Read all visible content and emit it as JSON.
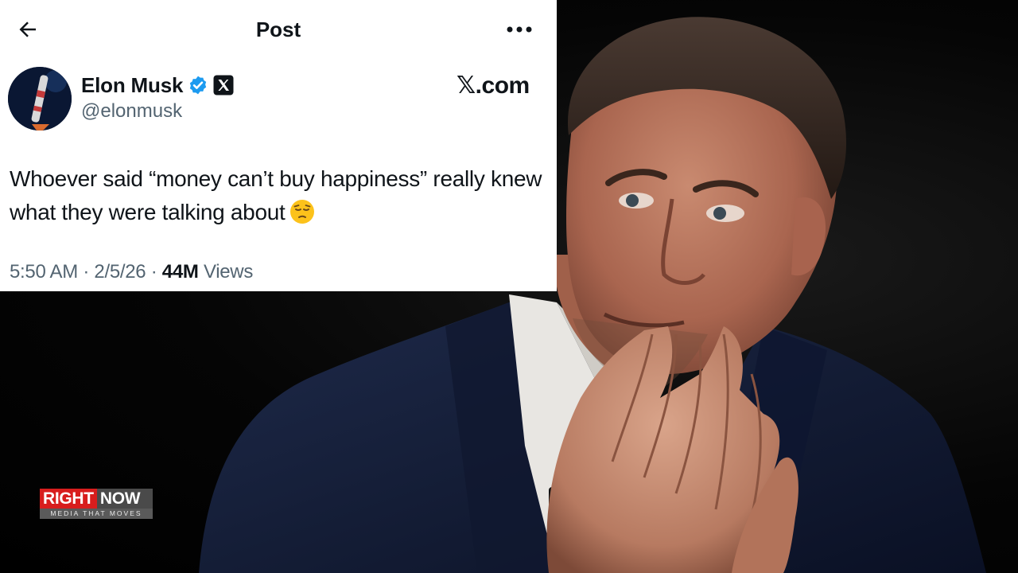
{
  "header": {
    "title": "Post",
    "back_icon": "arrow-left-icon",
    "more_icon": "more-horizontal-icon"
  },
  "author": {
    "display_name": "Elon Musk",
    "handle": "@elonmusk",
    "verified_icon": "verified-badge-icon",
    "affiliation_icon": "x-logo-icon",
    "verified_color": "#1d9bf0"
  },
  "source_label": "𝕏.com",
  "tweet": {
    "text": "Whoever said “money can’t buy happiness” really knew what they were talking about",
    "emoji": "pensive-face-emoji"
  },
  "meta": {
    "time": "5:50 AM",
    "sep1": " · ",
    "date": "2/5/26",
    "sep2": " · ",
    "views_count": "44M",
    "views_label": " Views"
  },
  "branding": {
    "word1": "RIGHT",
    "word2": "NOW",
    "tagline": "MEDIA THAT MOVES",
    "accent_color": "#d81d1d"
  }
}
